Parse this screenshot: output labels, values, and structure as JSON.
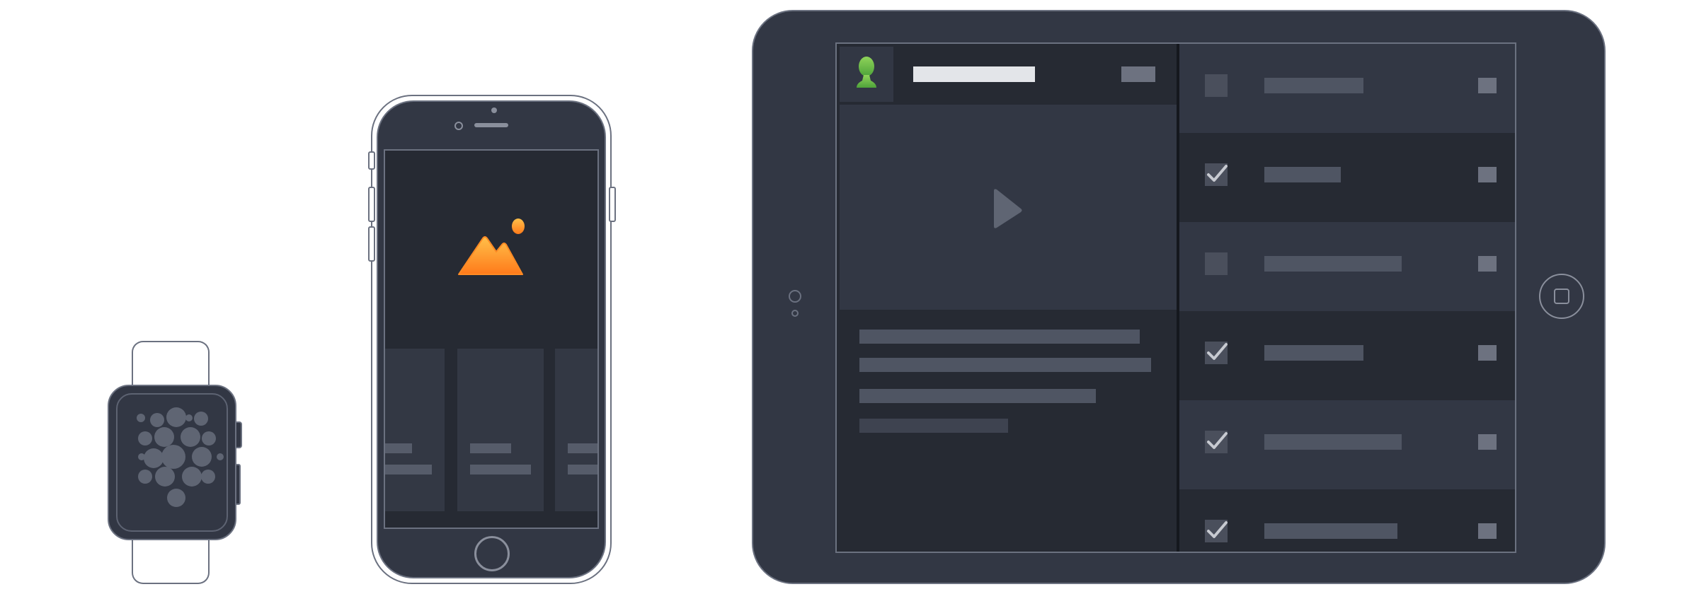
{
  "devices": {
    "watch": {
      "name": "smartwatch",
      "screen": "app-grid"
    },
    "phone": {
      "name": "phone",
      "screen": "image-gallery"
    },
    "tablet": {
      "name": "tablet",
      "screen": "split-view"
    }
  },
  "tablet": {
    "checklist": [
      {
        "checked": false
      },
      {
        "checked": true
      },
      {
        "checked": false
      },
      {
        "checked": true
      },
      {
        "checked": true
      },
      {
        "checked": true
      }
    ]
  },
  "icons": {
    "avatar": "user-icon",
    "media": "play-icon",
    "image": "image-icon",
    "check": "checkmark-icon"
  },
  "colors": {
    "device_frame": "#323744",
    "outline": "#6b7180",
    "screen_bg": "#262a33",
    "accent_orange": "#ff9a2e",
    "accent_green": "#6cc24a"
  }
}
